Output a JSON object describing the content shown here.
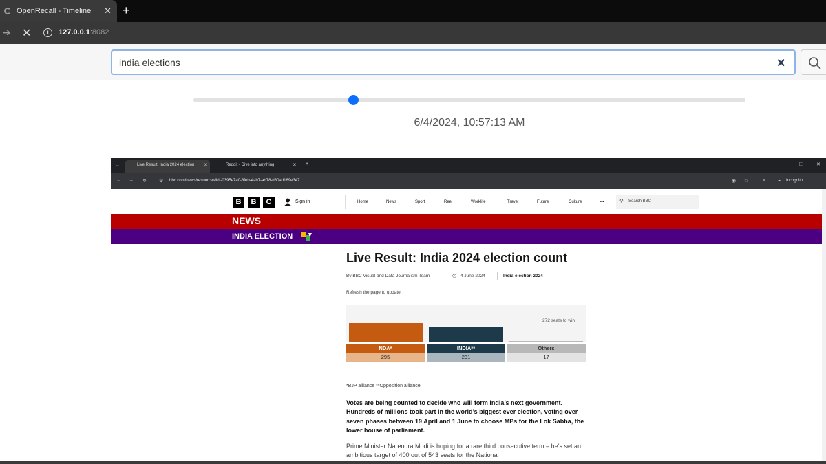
{
  "browser": {
    "tab_title": "OpenRecall - Timeline",
    "new_tab": "+",
    "url_host": "127.0.0.1",
    "url_port": ":8082"
  },
  "search": {
    "value": "india elections",
    "placeholder": ""
  },
  "timeline": {
    "position": 0.29,
    "timestamp": "6/4/2024, 10:57:13 AM"
  },
  "screenshot": {
    "tabs": [
      {
        "title": "Live Result: India 2024 election"
      },
      {
        "title": "Reddit - Dive into anything"
      }
    ],
    "url": "bbc.com/news/resources/idt-0395e7a0-3feb-4ab7-ab78-d80ad189e347",
    "incognito": "Incognito",
    "bbc": {
      "logo": [
        "B",
        "B",
        "C"
      ],
      "sign_in": "Sign in",
      "nav": [
        "Home",
        "News",
        "Sport",
        "Reel",
        "Worklife",
        "Travel",
        "Future",
        "Culture",
        "•••"
      ],
      "search": "Search BBC",
      "section": "NEWS",
      "subsection": "INDIA ELECTION"
    },
    "article": {
      "headline": "Live Result: India 2024 election count",
      "byline": "By BBC Visual and Data Journalism Team",
      "date": "4 June 2024",
      "topic": "India election 2024",
      "refresh": "Refresh the page to update",
      "footnote": "*BJP alliance **Opposition alliance",
      "intro": "Votes are being counted to decide who will form India’s next government. Hundreds of millions took part in the world’s biggest ever election, voting over seven phases between 19 April and 1 June to choose MPs for the Lok Sabha, the lower house of parliament.",
      "para": "Prime Minister Narendra Modi is hoping for a rare third consecutive term – he’s set an ambitious target of 400 out of 543 seats for the National"
    },
    "results": {
      "win_label": "272 seats to win",
      "parties": [
        {
          "name": "NDA*",
          "seats": "295",
          "color": "#c55a11"
        },
        {
          "name": "INDIA**",
          "seats": "231",
          "color": "#1c3a4a"
        },
        {
          "name": "Others",
          "seats": "17",
          "color": "#b8b8b8"
        }
      ]
    }
  },
  "colors": {
    "accent": "#0d6efd",
    "bbc_red": "#b80000",
    "election_purple": "#4b0082"
  }
}
